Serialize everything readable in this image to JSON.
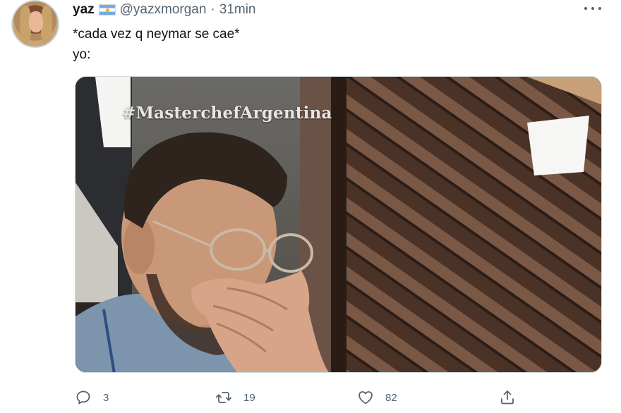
{
  "tweet": {
    "display_name": "yaz",
    "handle": "@yazxmorgan",
    "separator": "·",
    "time": "31min",
    "flag_icon": "argentina-flag-icon",
    "text_lines": [
      "*cada vez q neymar se cae*",
      "yo:"
    ]
  },
  "media": {
    "watermark": "#MasterchefArgentina",
    "accent": "#3a2a22"
  },
  "actions": {
    "reply_count": "3",
    "retweet_count": "19",
    "like_count": "82",
    "icon_color": "#536471"
  }
}
